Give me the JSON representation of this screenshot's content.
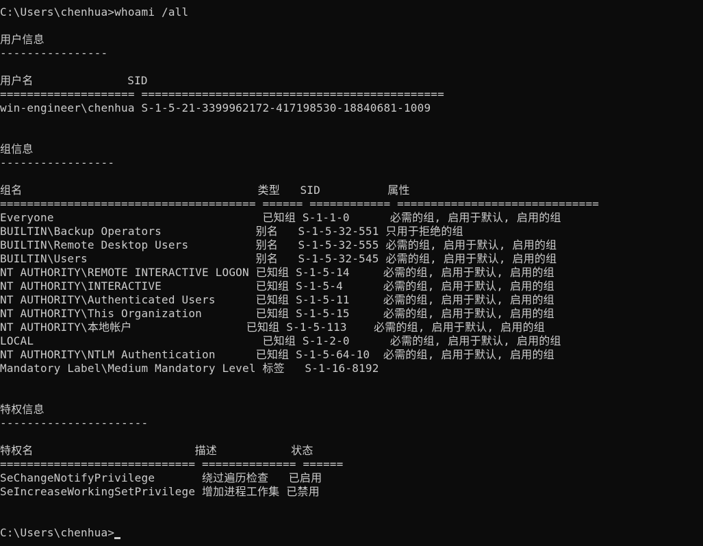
{
  "terminal": {
    "lines": [
      "C:\\Users\\chenhua>whoami /all",
      "",
      "用户信息",
      "----------------",
      "",
      "用户名              SID",
      "==================== =============================================",
      "win-engineer\\chenhua S-1-5-21-3399962172-417198530-18840681-1009",
      "",
      "",
      "组信息",
      "-----------------",
      "",
      "组名                                   类型   SID          属性",
      "====================================== ====== ============ ==============================",
      "Everyone                               已知组 S-1-1-0      必需的组, 启用于默认, 启用的组",
      "BUILTIN\\Backup Operators              别名   S-1-5-32-551 只用于拒绝的组",
      "BUILTIN\\Remote Desktop Users          别名   S-1-5-32-555 必需的组, 启用于默认, 启用的组",
      "BUILTIN\\Users                         别名   S-1-5-32-545 必需的组, 启用于默认, 启用的组",
      "NT AUTHORITY\\REMOTE INTERACTIVE LOGON 已知组 S-1-5-14     必需的组, 启用于默认, 启用的组",
      "NT AUTHORITY\\INTERACTIVE              已知组 S-1-5-4      必需的组, 启用于默认, 启用的组",
      "NT AUTHORITY\\Authenticated Users      已知组 S-1-5-11     必需的组, 启用于默认, 启用的组",
      "NT AUTHORITY\\This Organization        已知组 S-1-5-15     必需的组, 启用于默认, 启用的组",
      "NT AUTHORITY\\本地帐户                 已知组 S-1-5-113    必需的组, 启用于默认, 启用的组",
      "LOCAL                                  已知组 S-1-2-0      必需的组, 启用于默认, 启用的组",
      "NT AUTHORITY\\NTLM Authentication      已知组 S-1-5-64-10  必需的组, 启用于默认, 启用的组",
      "Mandatory Label\\Medium Mandatory Level 标签   S-1-16-8192",
      "",
      "",
      "特权信息",
      "----------------------",
      "",
      "特权名                        描述           状态",
      "============================= ============== ======",
      "SeChangeNotifyPrivilege       绕过遍历检查   已启用",
      "SeIncreaseWorkingSetPrivilege 增加进程工作集 已禁用",
      "",
      "",
      "C:\\Users\\chenhua>"
    ]
  }
}
